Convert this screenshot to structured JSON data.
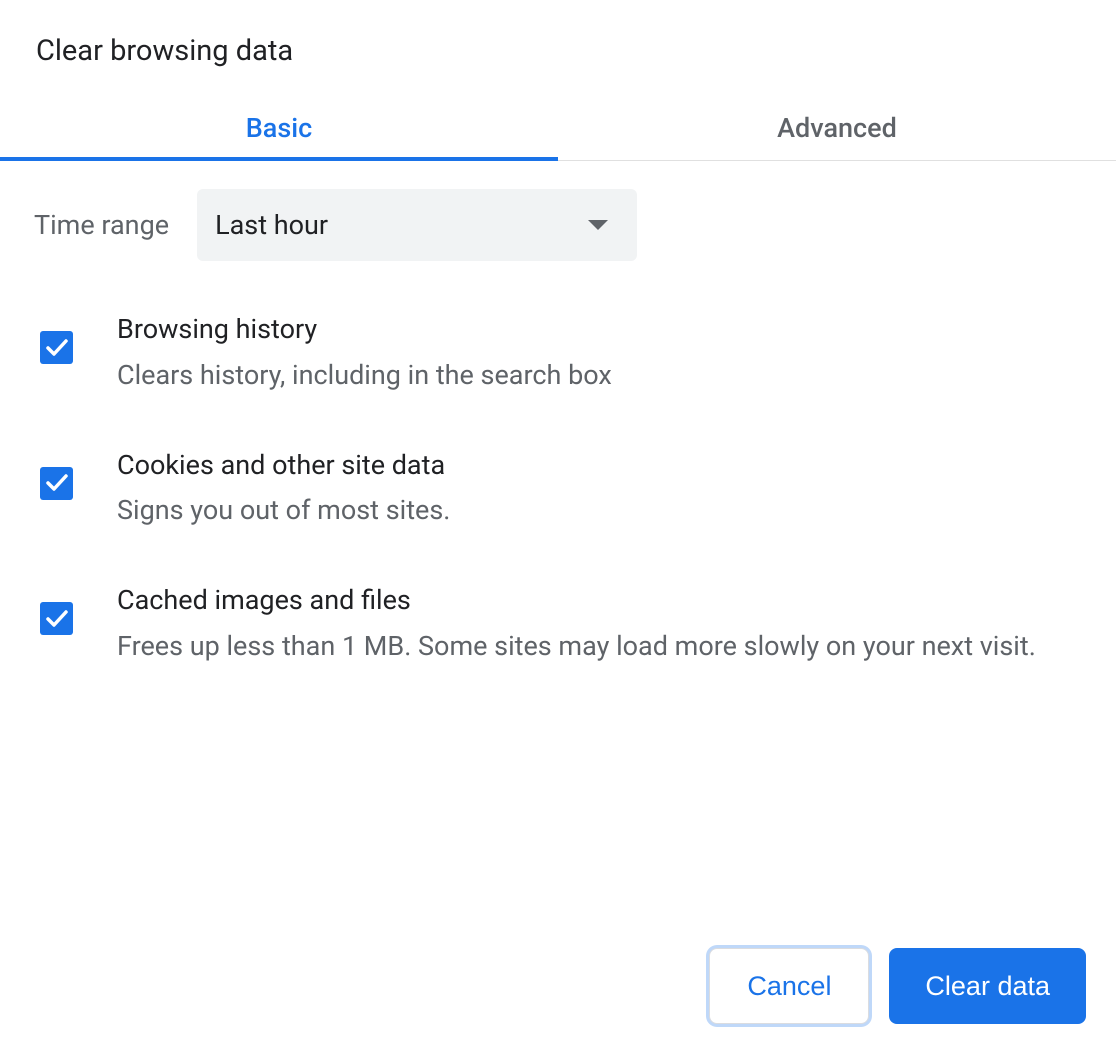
{
  "dialog": {
    "title": "Clear browsing data"
  },
  "tabs": {
    "basic": "Basic",
    "advanced": "Advanced",
    "active": "basic"
  },
  "time_range": {
    "label": "Time range",
    "value": "Last hour"
  },
  "options": [
    {
      "checked": true,
      "title": "Browsing history",
      "description": "Clears history, including in the search box"
    },
    {
      "checked": true,
      "title": "Cookies and other site data",
      "description": "Signs you out of most sites."
    },
    {
      "checked": true,
      "title": "Cached images and files",
      "description": "Frees up less than 1 MB. Some sites may load more slowly on your next visit."
    }
  ],
  "footer": {
    "cancel": "Cancel",
    "confirm": "Clear data"
  },
  "colors": {
    "accent": "#1a73e8",
    "text_secondary": "#5f6368",
    "select_bg": "#f1f3f4"
  }
}
